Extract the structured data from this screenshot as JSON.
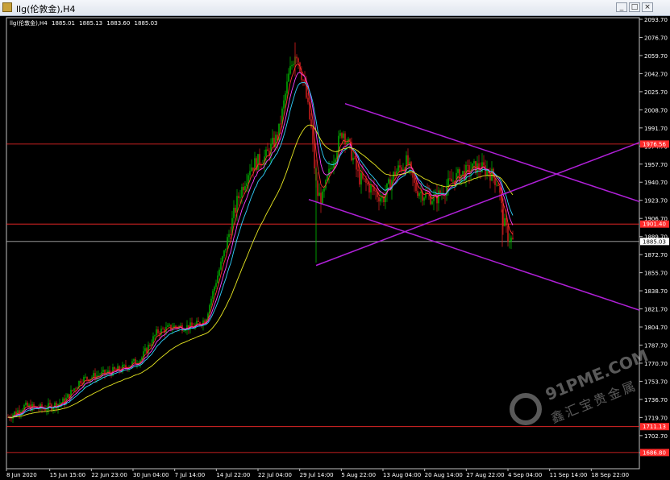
{
  "window": {
    "title": "llg(伦敦金),H4",
    "buttons": [
      "_",
      "□",
      "×"
    ]
  },
  "chart_header": {
    "symbol": "llg(伦敦金),H4",
    "open": "1885.01",
    "high": "1885.13",
    "low": "1883.60",
    "close": "1885.03"
  },
  "price_axis": {
    "ticks": [
      "2093.70",
      "2076.70",
      "2059.70",
      "2042.70",
      "2025.70",
      "2008.70",
      "1991.70",
      "1974.70",
      "1957.70",
      "1940.70",
      "1923.70",
      "1906.70",
      "1889.70",
      "1872.70",
      "1855.70",
      "1838.70",
      "1821.70",
      "1804.70",
      "1787.70",
      "1770.70",
      "1753.70",
      "1736.70",
      "1719.70",
      "1702.70",
      "1686.70"
    ]
  },
  "time_axis": {
    "labels": [
      "8 Jun 2020",
      "15 Jun 15:00",
      "22 Jun 23:00",
      "30 Jun 04:00",
      "7 Jul 14:00",
      "14 Jul 22:00",
      "22 Jul 04:00",
      "29 Jul 14:00",
      "5 Aug 22:00",
      "13 Aug 04:00",
      "20 Aug 14:00",
      "27 Aug 22:00",
      "4 Sep 04:00",
      "11 Sep 14:00",
      "18 Sep 22:00"
    ]
  },
  "horizontal_lines": [
    {
      "label": "1976.56",
      "price": 1976.56,
      "color": "#ff2a2a"
    },
    {
      "label": "1901.40",
      "price": 1901.4,
      "color": "#ff2a2a"
    },
    {
      "label": "1885.03",
      "price": 1885.03,
      "color": "#b0b0b0"
    },
    {
      "label": "1711.13",
      "price": 1711.13,
      "color": "#ff2a2a"
    },
    {
      "label": "1686.80",
      "price": 1686.8,
      "color": "#ff2a2a"
    }
  ],
  "colors": {
    "background": "#000000",
    "bull": "#00c000",
    "bear": "#e02020",
    "trendline": "#b020d8",
    "ma_fast": "#ff3030",
    "ma_mid": "#ff40ff",
    "ma_slow": "#30d0ff",
    "ma_long": "#e8e820"
  },
  "watermark": {
    "brand": "91PME.COM",
    "sub": "鑫汇宝贵金属"
  }
}
